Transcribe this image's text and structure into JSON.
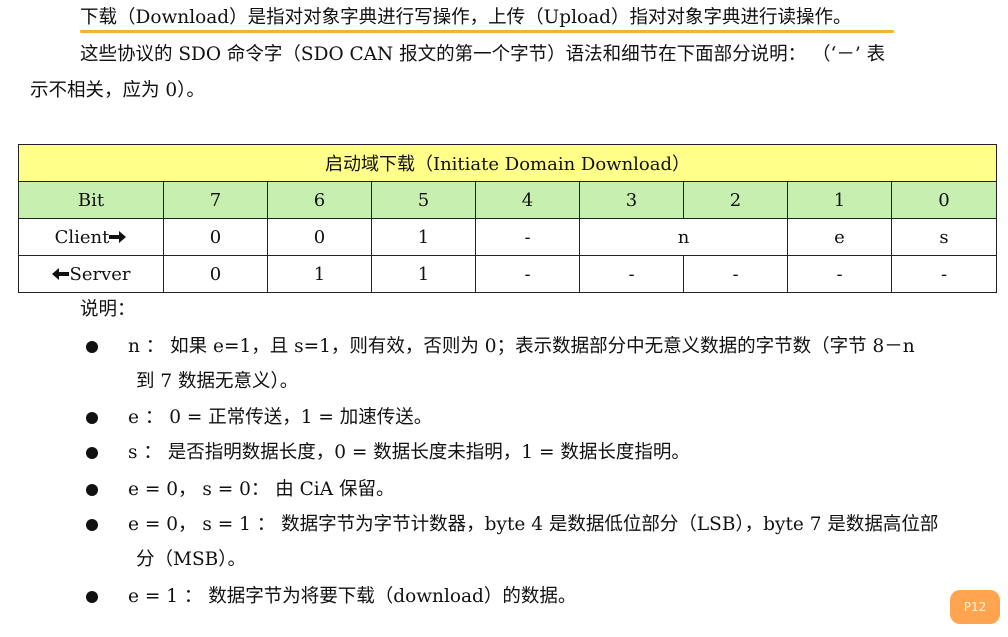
{
  "intro": {
    "line1": "下载（Download）是指对对象字典进行写操作，上传（Upload）指对对象字典进行读操作。",
    "line2": "这些协议的 SDO  命令字（SDO  CAN 报文的第一个字节）语法和细节在下面部分说明：  （‘－’ 表",
    "line3": "示不相关，应为 0）。"
  },
  "table": {
    "title": "启动域下载（Initiate Domain Download）",
    "header": [
      "Bit",
      "7",
      "6",
      "5",
      "4",
      "3",
      "2",
      "1",
      "0"
    ],
    "client": {
      "label": "Client",
      "cells": [
        "0",
        "0",
        "1",
        "-",
        "n",
        "e",
        "s"
      ]
    },
    "server": {
      "label": "Server",
      "cells": [
        "0",
        "1",
        "1",
        "-",
        "-",
        "-",
        "-",
        "-"
      ]
    }
  },
  "notes": {
    "label": "说明：",
    "items": [
      {
        "line1": "n  ：  如果 e=1，且 s=1，则有效，否则为 0；表示数据部分中无意义数据的字节数（字节 8－n",
        "line2": "到 7 数据无意义）。"
      },
      {
        "line1": "e  ：  0 =  正常传送，1 =  加速传送。"
      },
      {
        "line1": "s  ：  是否指明数据长度，0 =  数据长度未指明，1 =  数据长度指明。"
      },
      {
        "line1": "e = 0，   s = 0：   由 CiA 保留。"
      },
      {
        "line1": "e = 0，   s = 1  ：   数据字节为字节计数器，byte 4 是数据低位部分（LSB），byte 7 是数据高位部",
        "line2": "分（MSB）。"
      },
      {
        "line1": "e = 1  ：   数据字节为将要下载（download）的数据。"
      }
    ]
  },
  "badge": {
    "text": "P12"
  },
  "colors": {
    "title_bg": "#ffff8a",
    "bit_row_bg": "#c7f0b0",
    "underline": "#f2b233",
    "badge": "#ffa54f"
  }
}
